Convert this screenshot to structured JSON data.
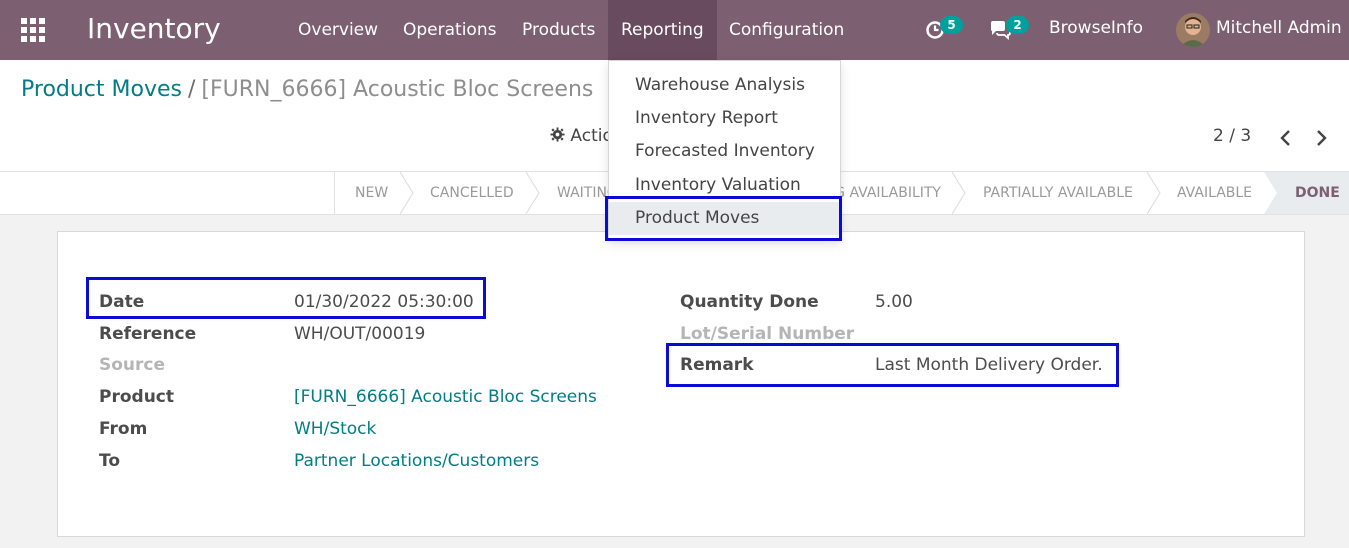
{
  "navbar": {
    "app_title": "Inventory",
    "menu": [
      "Overview",
      "Operations",
      "Products",
      "Reporting",
      "Configuration"
    ],
    "activity_count": "5",
    "message_count": "2",
    "company": "BrowseInfo",
    "user": "Mitchell Admin",
    "color": "#7c6072"
  },
  "breadcrumb": {
    "parent": "Product Moves",
    "separator": "/",
    "current": "[FURN_6666] Acoustic Bloc Screens"
  },
  "toolbar": {
    "action_label": "Action",
    "pager": "2 / 3"
  },
  "statusbar": {
    "states": [
      "NEW",
      "CANCELLED",
      "WAITING ANOTHER MOVE",
      "WAITING AVAILABILITY",
      "PARTIALLY AVAILABLE",
      "AVAILABLE",
      "DONE"
    ],
    "current": "DONE"
  },
  "reporting_menu": {
    "items": [
      "Warehouse Analysis",
      "Inventory Report",
      "Forecasted Inventory",
      "Inventory Valuation",
      "Product Moves"
    ],
    "selected": "Product Moves"
  },
  "form": {
    "date_label": "Date",
    "date_value": "01/30/2022 05:30:00",
    "reference_label": "Reference",
    "reference_value": "WH/OUT/00019",
    "source_label": "Source",
    "product_label": "Product",
    "product_value": "[FURN_6666] Acoustic Bloc Screens",
    "from_label": "From",
    "from_value": "WH/Stock",
    "to_label": "To",
    "to_value": "Partner Locations/Customers",
    "qty_label": "Quantity Done",
    "qty_value": "5.00",
    "lot_label": "Lot/Serial Number",
    "remark_label": "Remark",
    "remark_value": "Last Month Delivery Order."
  },
  "colors": {
    "link": "#017e84",
    "highlight": "#0b0bd6",
    "badge": "#00a09d"
  }
}
